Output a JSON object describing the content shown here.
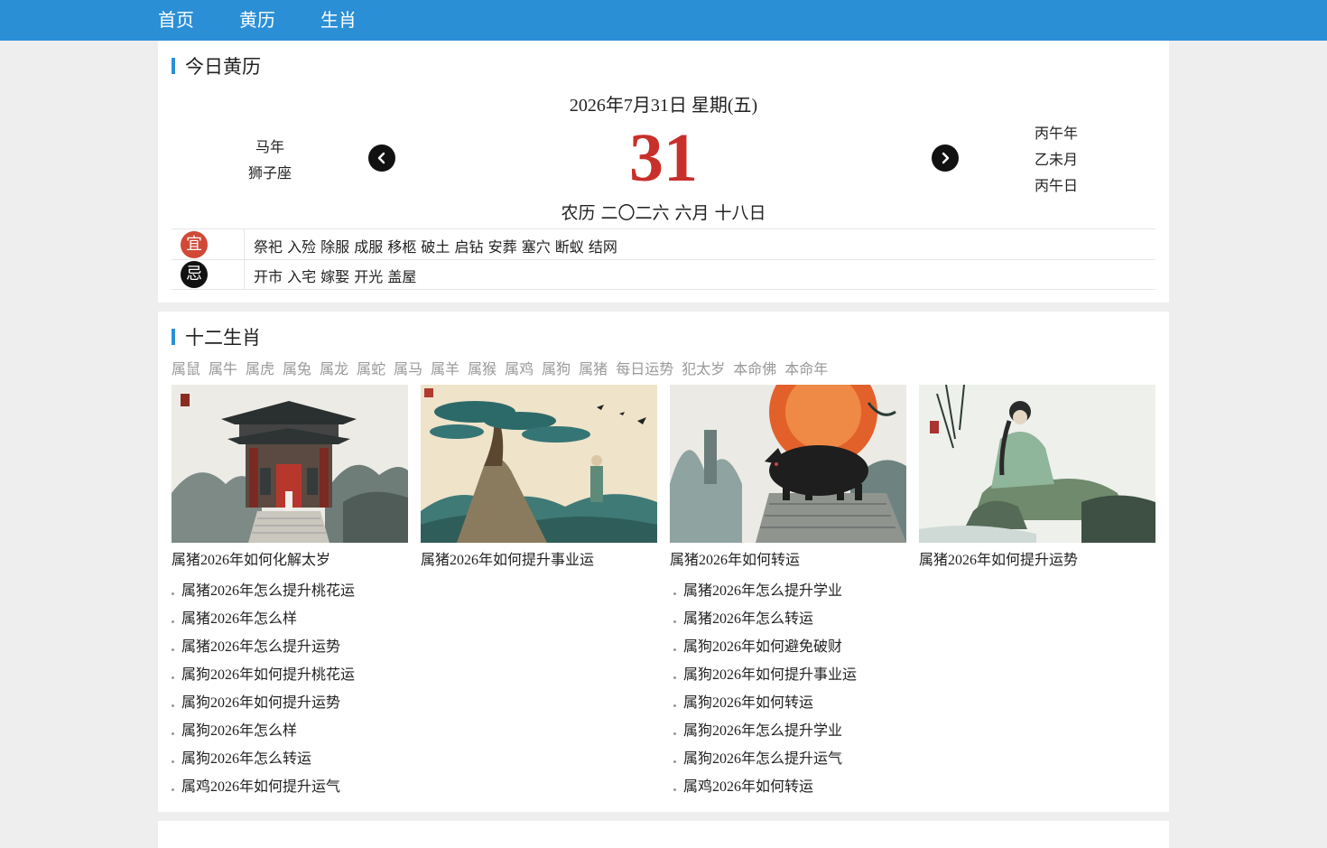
{
  "nav": [
    "首页",
    "黄历",
    "生肖"
  ],
  "almanac": {
    "section_title": "今日黄历",
    "date_line": "2026年7月31日 星期(五)",
    "day": "31",
    "lunar": "农历 二〇二六 六月 十八日",
    "zodiac_year": "马年",
    "constellation": "狮子座",
    "ganzhi_year": "丙午年",
    "ganzhi_month": "乙未月",
    "ganzhi_day": "丙午日",
    "prev_icon": "chevron-left-icon",
    "next_icon": "chevron-right-icon",
    "yi_label": "宜",
    "yi_color": "#d14836",
    "yi": "祭祀 入殓 除服 成服 移柩 破土 启钻 安葬 塞穴 断蚁 结网",
    "ji_label": "忌",
    "ji_color": "#111111",
    "ji": "开市 入宅 嫁娶 开光 盖屋"
  },
  "zodiac": {
    "section_title": "十二生肖",
    "tabs": [
      "属鼠",
      "属牛",
      "属虎",
      "属兔",
      "属龙",
      "属蛇",
      "属马",
      "属羊",
      "属猴",
      "属鸡",
      "属狗",
      "属猪",
      "每日运势",
      "犯太岁",
      "本命佛",
      "本命年"
    ],
    "cards": [
      {
        "caption": "属猪2026年如何化解太岁"
      },
      {
        "caption": "属猪2026年如何提升事业运"
      },
      {
        "caption": "属猪2026年如何转运"
      },
      {
        "caption": "属猪2026年如何提升运势"
      }
    ],
    "links_left": [
      "属猪2026年怎么提升桃花运",
      "属猪2026年怎么样",
      "属猪2026年怎么提升运势",
      "属狗2026年如何提升桃花运",
      "属狗2026年如何提升运势",
      "属狗2026年怎么样",
      "属狗2026年怎么转运",
      "属鸡2026年如何提升运气"
    ],
    "links_right": [
      "属猪2026年怎么提升学业",
      "属猪2026年怎么转运",
      "属狗2026年如何避免破财",
      "属狗2026年如何提升事业运",
      "属狗2026年如何转运",
      "属狗2026年怎么提升学业",
      "属狗2026年怎么提升运气",
      "属鸡2026年如何转运"
    ]
  },
  "colors": {
    "nav": "#2b8fd6",
    "accent": "#2b8fd6",
    "day": "#c8302c"
  }
}
